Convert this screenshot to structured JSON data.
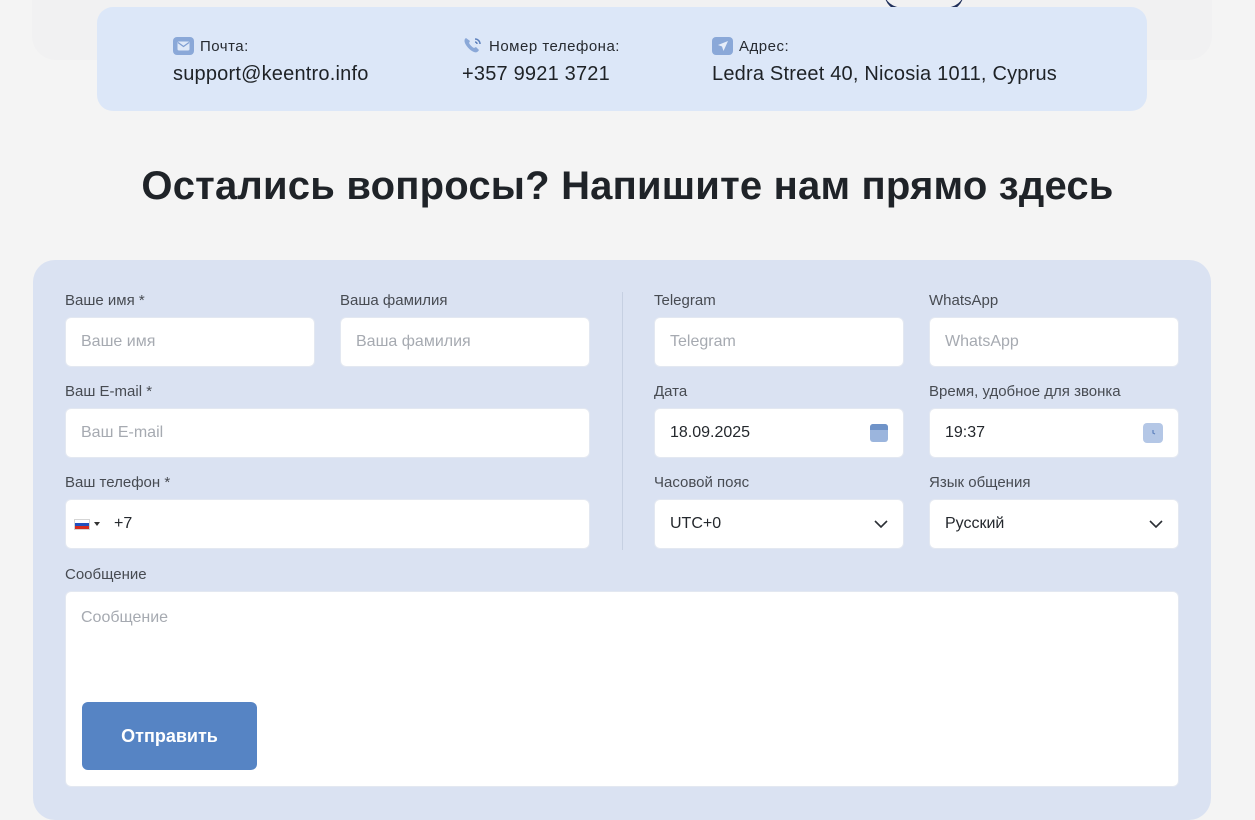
{
  "contacts": {
    "email": {
      "label": "Почта:",
      "value": "support@keentro.info",
      "icon": "mail-icon"
    },
    "phone": {
      "label": "Номер телефона:",
      "value": "+357 9921 3721",
      "icon": "phone-icon"
    },
    "address": {
      "label": "Адрес:",
      "value": "Ledra Street 40, Nicosia 1011, Cyprus",
      "icon": "send-icon"
    }
  },
  "section": {
    "title": "Остались вопросы? Напишите нам прямо здесь"
  },
  "form": {
    "first_name": {
      "label": "Ваше имя *",
      "placeholder": "Ваше имя"
    },
    "last_name": {
      "label": "Ваша фамилия",
      "placeholder": "Ваша фамилия"
    },
    "email": {
      "label": "Ваш E-mail *",
      "placeholder": "Ваш E-mail"
    },
    "phone": {
      "label": "Ваш телефон *",
      "code": "+7",
      "country": "RU"
    },
    "telegram": {
      "label": "Telegram",
      "placeholder": "Telegram"
    },
    "whatsapp": {
      "label": "WhatsApp",
      "placeholder": "WhatsApp"
    },
    "date": {
      "label": "Дата",
      "value": "18.09.2025"
    },
    "time": {
      "label": "Время, удобное для звонка",
      "value": "19:37"
    },
    "timezone": {
      "label": "Часовой пояс",
      "value": "UTC+0"
    },
    "language": {
      "label": "Язык общения",
      "value": "Русский"
    },
    "message": {
      "label": "Сообщение",
      "placeholder": "Сообщение"
    },
    "submit_label": "Отправить"
  },
  "colors": {
    "accent": "#5684c4",
    "card": "#dae2f2",
    "contact_bar": "#dce7f8"
  }
}
